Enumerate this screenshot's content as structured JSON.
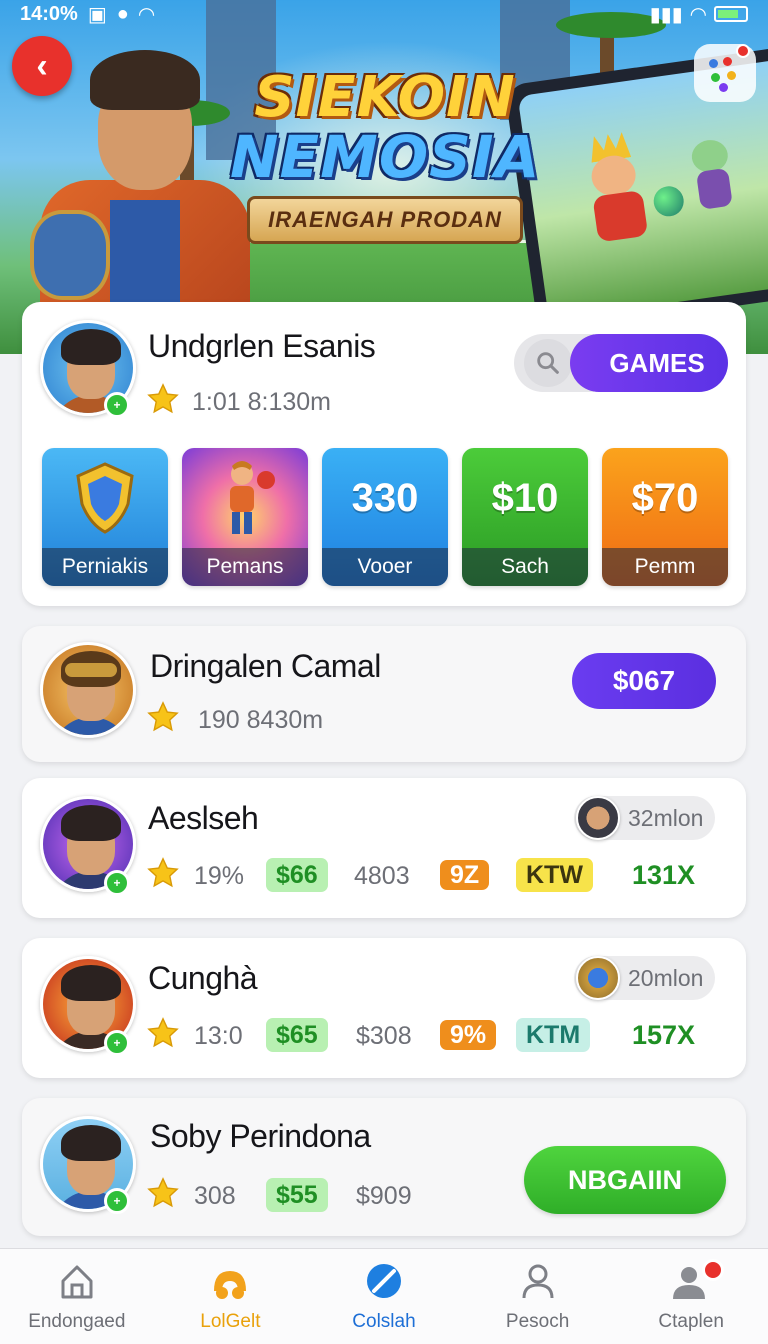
{
  "status_bar": {
    "time": "14:0%"
  },
  "banner": {
    "title_line1": "SIEKOIN",
    "title_line2": "NEMOSIA",
    "ribbon": "IRAENGAH PRODAN"
  },
  "colors": {
    "accent_purple": "#5b32e6",
    "accent_green": "#2fae28",
    "back_red": "#e8312c"
  },
  "cards": [
    {
      "name": "Undgrlen Esanis",
      "meta": "1:01 8:130m",
      "search_icon": "search-icon",
      "games_label": "GAMES",
      "tiles": [
        {
          "big": "",
          "label": "Perniakis",
          "icon": "shield-icon"
        },
        {
          "big": "",
          "label": "Pemans",
          "icon": "player-icon"
        },
        {
          "big": "330",
          "label": "Vooer"
        },
        {
          "big": "$10",
          "label": "Sach"
        },
        {
          "big": "$70",
          "label": "Pemm"
        }
      ]
    },
    {
      "name": "Dringalen Camal",
      "meta": "190 8430m",
      "price": "$067"
    },
    {
      "name": "Aeslseh",
      "meta": "19%",
      "pill_green": "$66",
      "plain_gray": "4803",
      "pill_orange": "9Z",
      "pill_yellow": "KTW",
      "plain_green": "131X",
      "chip_text": "32mlon"
    },
    {
      "name": "Cunghà",
      "meta": "13:0",
      "pill_green": "$65",
      "plain_gray": "$308",
      "pill_orange": "9%",
      "pill_teal": "KTM",
      "plain_green": "157X",
      "chip_text": "20mlon"
    },
    {
      "name": "Soby Perindona",
      "meta": "308",
      "pill_green": "$55",
      "plain_gray": "$909",
      "button": "NBGAIIN"
    }
  ],
  "nav": [
    {
      "label": "Endongaed",
      "icon": "home-icon"
    },
    {
      "label": "LolGelt",
      "icon": "coins-icon"
    },
    {
      "label": "Colslah",
      "icon": "compass-icon"
    },
    {
      "label": "Pesoch",
      "icon": "person-icon"
    },
    {
      "label": "Ctaplen",
      "icon": "profile-icon"
    }
  ]
}
